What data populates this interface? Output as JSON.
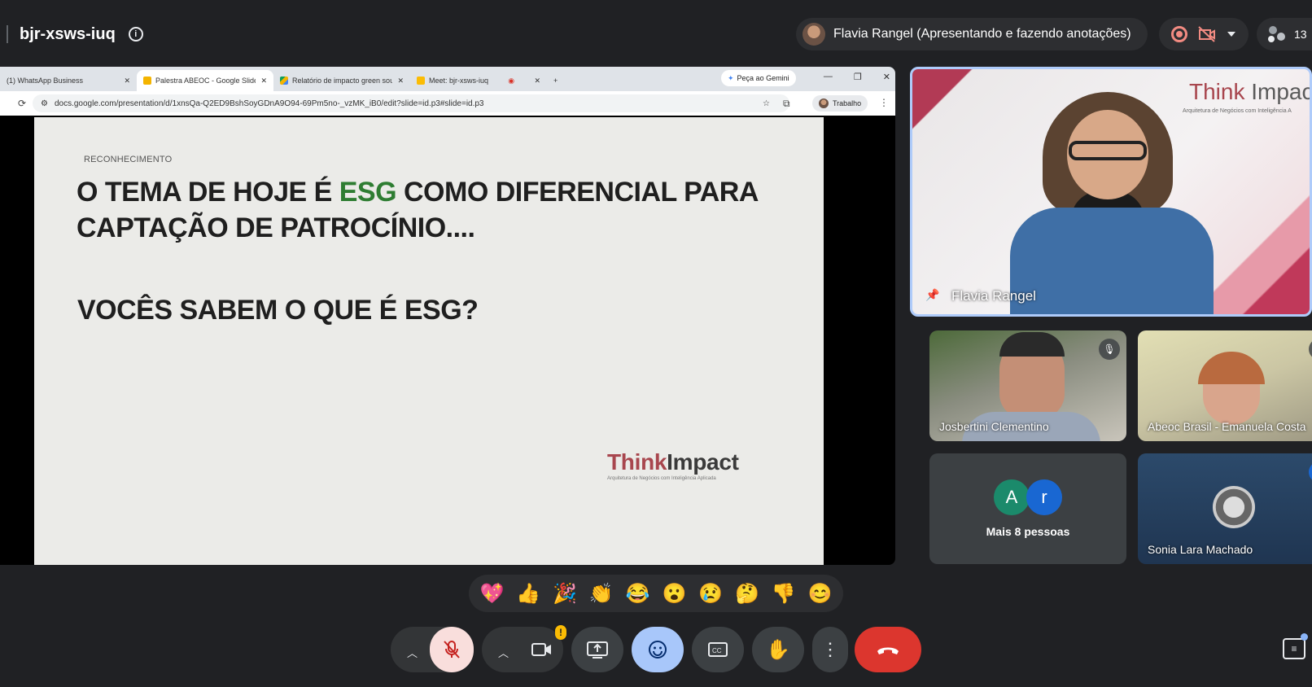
{
  "meeting": {
    "code": "bjr-xsws-iuq",
    "participant_count": "13"
  },
  "presenter_chip": {
    "label": "Flavia Rangel (Apresentando e fazendo anotações)"
  },
  "browser": {
    "tabs": [
      {
        "title": "(1) WhatsApp Business",
        "active": false
      },
      {
        "title": "Palestra ABEOC - Google Slides",
        "active": true
      },
      {
        "title": "Relatório de impacto green sou",
        "active": false
      },
      {
        "title": "Meet: bjr-xsws-iuq",
        "active": false
      }
    ],
    "gemini_button": "Peça ao Gemini",
    "url": "docs.google.com/presentation/d/1xnsQa-Q2ED9BshSoyGDnA9O94-69Pm5no-_vzMK_iB0/edit?slide=id.p3#slide=id.p3",
    "profile_label": "Trabalho"
  },
  "slide": {
    "kicker": "RECONHECIMENTO",
    "headline_pre": "O TEMA DE HOJE É ",
    "headline_accent": "ESG",
    "headline_post": " COMO DIFERENCIAL PARA CAPTAÇÃO DE PATROCÍNIO....",
    "question": "VOCÊS SABEM O QUE É ESG?",
    "logo_part1": "Think",
    "logo_part2": "Impact",
    "logo_tagline": "Arquitetura de Negócios com Inteligência Aplicada"
  },
  "participants": {
    "main": {
      "name": "Flavia Rangel",
      "bg_title_1": "Think",
      "bg_title_2": " Impac",
      "bg_sub": "Arquitetura de Negócios com Inteligência A"
    },
    "tiles": [
      {
        "name": "Josbertini Clementino",
        "muted": true
      },
      {
        "name": "Abeoc Brasil - Emanuela Costa",
        "muted": true
      },
      {
        "name": "Sonia Lara Machado",
        "muted": true
      }
    ],
    "more": {
      "avatars": [
        "A",
        "r"
      ],
      "label": "Mais 8 pessoas"
    }
  },
  "reactions": [
    "💖",
    "👍",
    "🎉",
    "👏",
    "😂",
    "😮",
    "😢",
    "🤔",
    "👎",
    "😊"
  ],
  "colors": {
    "accent_esg": "#2e7d32",
    "brand": "#a8464e",
    "end_call": "#dc362e",
    "mic_muted_bg": "#f9dedc",
    "active_btn": "#a8c7fa"
  }
}
